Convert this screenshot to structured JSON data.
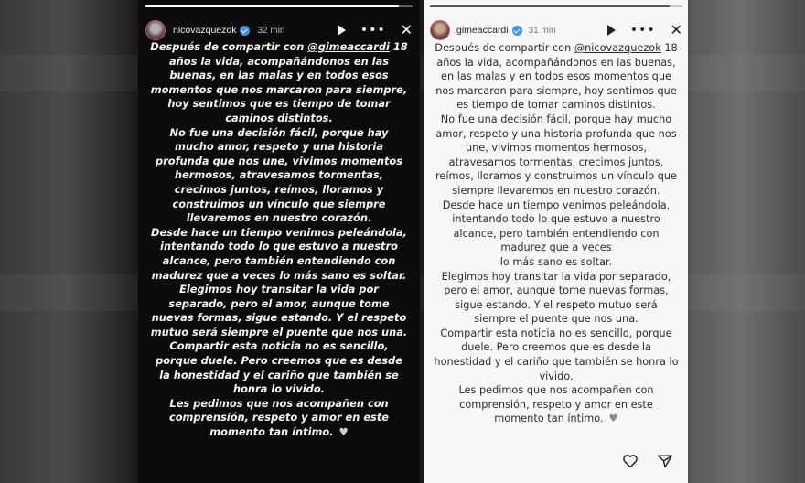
{
  "left_story": {
    "username": "nicovazquezok",
    "time": "32 min",
    "icons": {
      "play": "play-icon",
      "more": "more-dots-icon",
      "close": "close-icon",
      "heart": "heart-icon"
    },
    "more_glyph": "•••",
    "close_glyph": "✕",
    "heart_glyph": "♥",
    "progress": 0.95,
    "paragraphs": [
      {
        "before": "Después de compartir con ",
        "mention": "@gimeaccardi",
        "after": " 18 años la vida, acompañándonos en las buenas, en las malas y en todos esos momentos que nos marcaron para siempre, hoy sentimos que es tiempo de tomar caminos distintos."
      },
      {
        "text": "No fue una decisión fácil, porque hay mucho amor, respeto y una historia profunda que nos une, vivimos momentos hermosos, atravesamos tormentas, crecimos juntos, reímos, lloramos y construimos un vínculo que siempre llevaremos en nuestro corazón."
      },
      {
        "text": "Desde hace un tiempo venimos peleándola, intentando todo lo que estuvo a nuestro alcance, pero también entendiendo con madurez que a veces lo más sano es soltar."
      },
      {
        "text": "Elegimos hoy transitar la vida por separado, pero el amor, aunque tome nuevas formas, sigue estando. Y el respeto mutuo será siempre el puente que nos una."
      },
      {
        "text": "Compartir esta noticia no es sencillo, porque duele. Pero creemos que es desde la honestidad y el cariño que también se honra lo vivido."
      },
      {
        "text": "Les pedimos que nos acompañen con comprensión, respeto y amor en este momento tan  íntimo."
      }
    ]
  },
  "right_story": {
    "username": "gimeaccardi",
    "time": "31 min",
    "icons": {
      "play": "play-icon",
      "more": "more-dots-icon",
      "close": "close-icon",
      "like": "like-heart-icon",
      "send": "send-icon",
      "heart": "heart-icon"
    },
    "more_glyph": "•••",
    "close_glyph": "✕",
    "heart_glyph": "♥",
    "progress": 0.95,
    "paragraphs": [
      {
        "before": "Después de compartir con ",
        "mention": "@nicovazquezok",
        "after": " 18 años la vida, acompañándonos en las buenas, en las malas y en todos esos momentos que nos marcaron para siempre, hoy sentimos que es tiempo de tomar caminos distintos."
      },
      {
        "text": "No fue una decisión fácil, porque hay mucho amor, respeto y una historia profunda que nos une, vivimos  momentos hermosos, atravesamos tormentas, crecimos juntos, reímos, lloramos y construimos un vínculo que siempre llevaremos en nuestro corazón."
      },
      {
        "text": "Desde hace un tiempo venimos peleándola, intentando todo lo que estuvo a nuestro alcance, pero también entendiendo con madurez que a veces"
      },
      {
        "text": "lo más sano es soltar."
      },
      {
        "text": "Elegimos hoy transitar la vida por separado, pero el amor, aunque tome nuevas formas, sigue estando. Y el respeto mutuo será siempre el puente que nos una."
      },
      {
        "text": "Compartir esta noticia no es sencillo, porque duele. Pero creemos que es desde la honestidad y el cariño que también se honra lo vivido."
      },
      {
        "text": "Les pedimos que nos acompañen con comprensión, respeto y amor en este momento tan íntimo."
      }
    ]
  },
  "colors": {
    "verified": "#3897f0",
    "story_ring": "#d94d8f",
    "left_bg": "#0b0b0b",
    "right_bg": "#f7f7f7"
  }
}
